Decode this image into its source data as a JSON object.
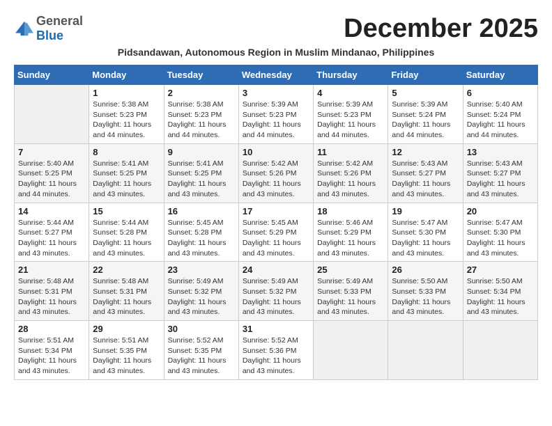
{
  "logo": {
    "general": "General",
    "blue": "Blue"
  },
  "title": "December 2025",
  "subtitle": "Pidsandawan, Autonomous Region in Muslim Mindanao, Philippines",
  "headers": [
    "Sunday",
    "Monday",
    "Tuesday",
    "Wednesday",
    "Thursday",
    "Friday",
    "Saturday"
  ],
  "weeks": [
    [
      {
        "day": "",
        "info": ""
      },
      {
        "day": "1",
        "info": "Sunrise: 5:38 AM\nSunset: 5:23 PM\nDaylight: 11 hours\nand 44 minutes."
      },
      {
        "day": "2",
        "info": "Sunrise: 5:38 AM\nSunset: 5:23 PM\nDaylight: 11 hours\nand 44 minutes."
      },
      {
        "day": "3",
        "info": "Sunrise: 5:39 AM\nSunset: 5:23 PM\nDaylight: 11 hours\nand 44 minutes."
      },
      {
        "day": "4",
        "info": "Sunrise: 5:39 AM\nSunset: 5:23 PM\nDaylight: 11 hours\nand 44 minutes."
      },
      {
        "day": "5",
        "info": "Sunrise: 5:39 AM\nSunset: 5:24 PM\nDaylight: 11 hours\nand 44 minutes."
      },
      {
        "day": "6",
        "info": "Sunrise: 5:40 AM\nSunset: 5:24 PM\nDaylight: 11 hours\nand 44 minutes."
      }
    ],
    [
      {
        "day": "7",
        "info": "Sunrise: 5:40 AM\nSunset: 5:25 PM\nDaylight: 11 hours\nand 44 minutes."
      },
      {
        "day": "8",
        "info": "Sunrise: 5:41 AM\nSunset: 5:25 PM\nDaylight: 11 hours\nand 43 minutes."
      },
      {
        "day": "9",
        "info": "Sunrise: 5:41 AM\nSunset: 5:25 PM\nDaylight: 11 hours\nand 43 minutes."
      },
      {
        "day": "10",
        "info": "Sunrise: 5:42 AM\nSunset: 5:26 PM\nDaylight: 11 hours\nand 43 minutes."
      },
      {
        "day": "11",
        "info": "Sunrise: 5:42 AM\nSunset: 5:26 PM\nDaylight: 11 hours\nand 43 minutes."
      },
      {
        "day": "12",
        "info": "Sunrise: 5:43 AM\nSunset: 5:27 PM\nDaylight: 11 hours\nand 43 minutes."
      },
      {
        "day": "13",
        "info": "Sunrise: 5:43 AM\nSunset: 5:27 PM\nDaylight: 11 hours\nand 43 minutes."
      }
    ],
    [
      {
        "day": "14",
        "info": "Sunrise: 5:44 AM\nSunset: 5:27 PM\nDaylight: 11 hours\nand 43 minutes."
      },
      {
        "day": "15",
        "info": "Sunrise: 5:44 AM\nSunset: 5:28 PM\nDaylight: 11 hours\nand 43 minutes."
      },
      {
        "day": "16",
        "info": "Sunrise: 5:45 AM\nSunset: 5:28 PM\nDaylight: 11 hours\nand 43 minutes."
      },
      {
        "day": "17",
        "info": "Sunrise: 5:45 AM\nSunset: 5:29 PM\nDaylight: 11 hours\nand 43 minutes."
      },
      {
        "day": "18",
        "info": "Sunrise: 5:46 AM\nSunset: 5:29 PM\nDaylight: 11 hours\nand 43 minutes."
      },
      {
        "day": "19",
        "info": "Sunrise: 5:47 AM\nSunset: 5:30 PM\nDaylight: 11 hours\nand 43 minutes."
      },
      {
        "day": "20",
        "info": "Sunrise: 5:47 AM\nSunset: 5:30 PM\nDaylight: 11 hours\nand 43 minutes."
      }
    ],
    [
      {
        "day": "21",
        "info": "Sunrise: 5:48 AM\nSunset: 5:31 PM\nDaylight: 11 hours\nand 43 minutes."
      },
      {
        "day": "22",
        "info": "Sunrise: 5:48 AM\nSunset: 5:31 PM\nDaylight: 11 hours\nand 43 minutes."
      },
      {
        "day": "23",
        "info": "Sunrise: 5:49 AM\nSunset: 5:32 PM\nDaylight: 11 hours\nand 43 minutes."
      },
      {
        "day": "24",
        "info": "Sunrise: 5:49 AM\nSunset: 5:32 PM\nDaylight: 11 hours\nand 43 minutes."
      },
      {
        "day": "25",
        "info": "Sunrise: 5:49 AM\nSunset: 5:33 PM\nDaylight: 11 hours\nand 43 minutes."
      },
      {
        "day": "26",
        "info": "Sunrise: 5:50 AM\nSunset: 5:33 PM\nDaylight: 11 hours\nand 43 minutes."
      },
      {
        "day": "27",
        "info": "Sunrise: 5:50 AM\nSunset: 5:34 PM\nDaylight: 11 hours\nand 43 minutes."
      }
    ],
    [
      {
        "day": "28",
        "info": "Sunrise: 5:51 AM\nSunset: 5:34 PM\nDaylight: 11 hours\nand 43 minutes."
      },
      {
        "day": "29",
        "info": "Sunrise: 5:51 AM\nSunset: 5:35 PM\nDaylight: 11 hours\nand 43 minutes."
      },
      {
        "day": "30",
        "info": "Sunrise: 5:52 AM\nSunset: 5:35 PM\nDaylight: 11 hours\nand 43 minutes."
      },
      {
        "day": "31",
        "info": "Sunrise: 5:52 AM\nSunset: 5:36 PM\nDaylight: 11 hours\nand 43 minutes."
      },
      {
        "day": "",
        "info": ""
      },
      {
        "day": "",
        "info": ""
      },
      {
        "day": "",
        "info": ""
      }
    ]
  ]
}
